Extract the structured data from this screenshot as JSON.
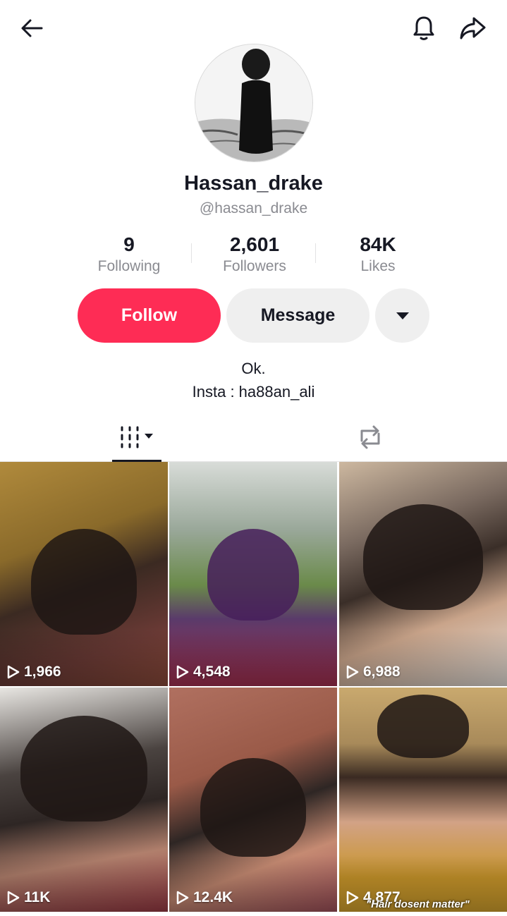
{
  "profile": {
    "display_name": "Hassan_drake",
    "handle": "@hassan_drake",
    "bio_line1": "Ok.",
    "bio_line2": "Insta : ha88an_ali"
  },
  "stats": {
    "following": {
      "value": "9",
      "label": "Following"
    },
    "followers": {
      "value": "2,601",
      "label": "Followers"
    },
    "likes": {
      "value": "84K",
      "label": "Likes"
    }
  },
  "actions": {
    "follow_label": "Follow",
    "message_label": "Message"
  },
  "tabs": {
    "videos_icon": "grid-videos-icon",
    "reposts_icon": "repost-icon",
    "active": "videos"
  },
  "videos": [
    {
      "views": "1,966"
    },
    {
      "views": "4,548"
    },
    {
      "views": "6,988"
    },
    {
      "views": "11K"
    },
    {
      "views": "12.4K"
    },
    {
      "views": "4,877",
      "caption": "\"Hair dosent matter\""
    }
  ],
  "colors": {
    "accent": "#fe2c55",
    "text": "#161823",
    "secondary_text": "#8a8b91",
    "button_gray": "#efefef"
  }
}
